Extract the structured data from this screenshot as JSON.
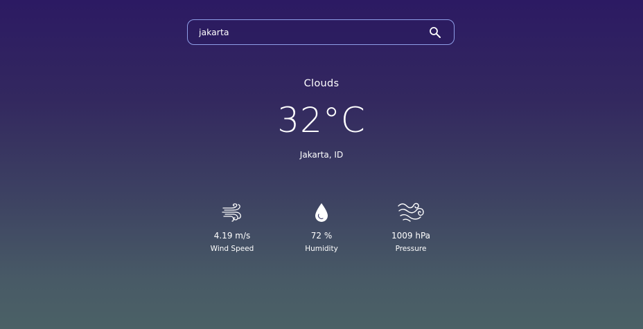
{
  "search": {
    "value": "jakarta",
    "placeholder": ""
  },
  "weather": {
    "condition": "Clouds",
    "temperature": "32°C",
    "location": "Jakarta, ID"
  },
  "stats": [
    {
      "icon": "wind-icon",
      "value": "4.19 m/s",
      "label": "Wind Speed"
    },
    {
      "icon": "humidity-icon",
      "value": "72 %",
      "label": "Humidity"
    },
    {
      "icon": "pressure-icon",
      "value": "1009 hPa",
      "label": "Pressure"
    }
  ],
  "colors": {
    "accent_border": "#8f9fe8",
    "text": "#ffffff"
  }
}
